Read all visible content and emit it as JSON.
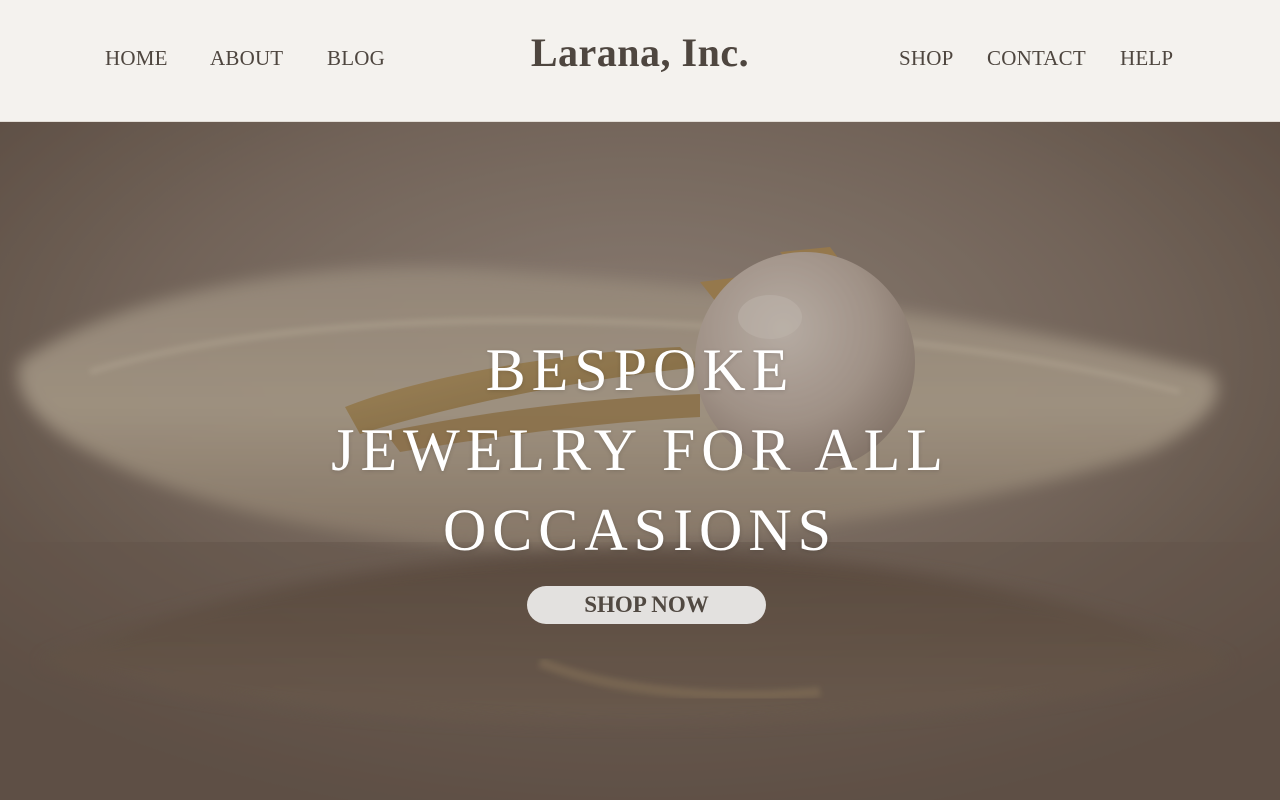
{
  "header": {
    "brand": "Larana, Inc.",
    "nav_left": [
      "HOME",
      "ABOUT",
      "BLOG"
    ],
    "nav_right": [
      "SHOP",
      "CONTACT",
      "HELP"
    ]
  },
  "hero": {
    "headline": [
      "BESPOKE",
      "JEWELRY FOR ALL",
      "OCCASIONS"
    ],
    "cta_label": "SHOP NOW",
    "photo": "pearl-ring-on-seashell"
  },
  "colors": {
    "header_bg": "#f4f2ee",
    "text_dark": "#4e463f",
    "hero_overlay": "#6d5e53",
    "button_bg": "#e3e1df"
  }
}
